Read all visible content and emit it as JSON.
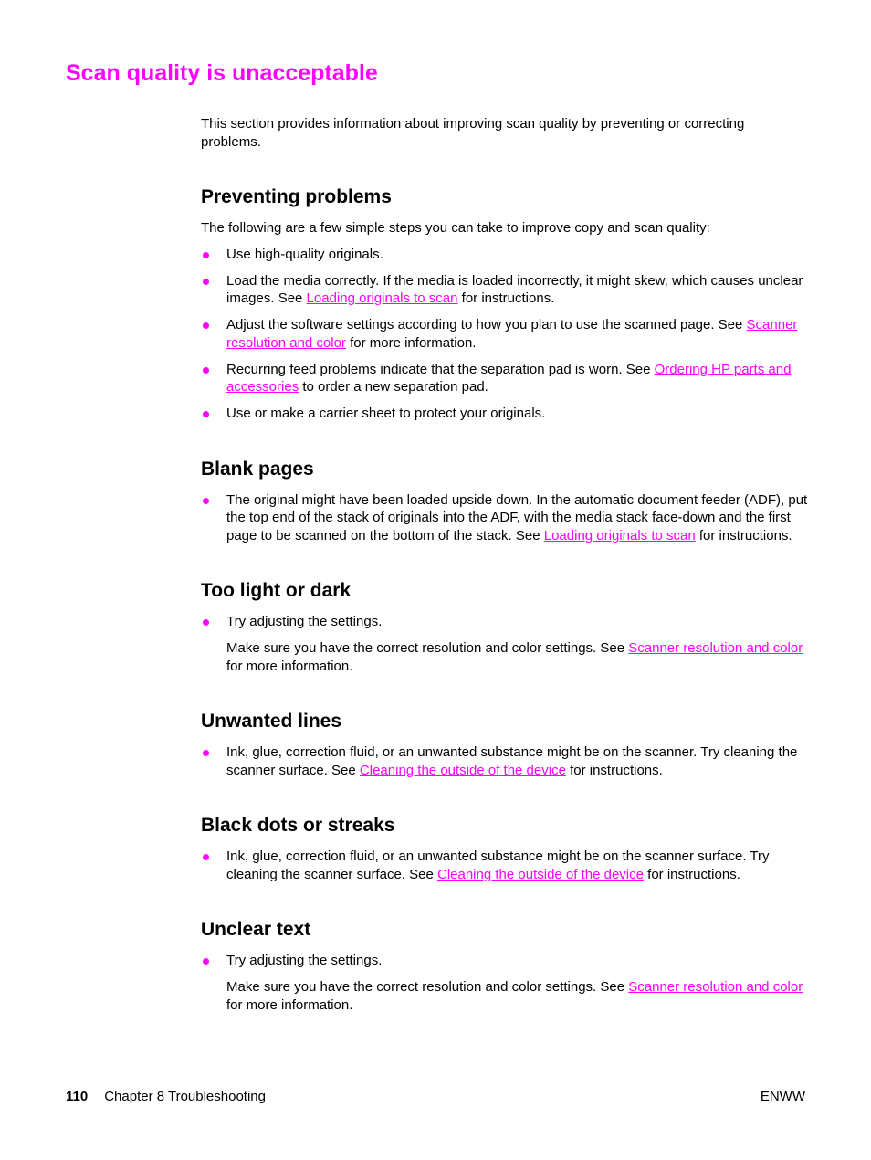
{
  "page_title": "Scan quality is unacceptable",
  "intro": "This section provides information about improving scan quality by preventing or correcting problems.",
  "sections": [
    {
      "heading": "Preventing problems",
      "lead": "The following are a few simple steps you can take to improve copy and scan quality:",
      "items": [
        {
          "before": "Use high-quality originals.",
          "link": "",
          "after": ""
        },
        {
          "before": "Load the media correctly. If the media is loaded incorrectly, it might skew, which causes unclear images. See ",
          "link": "Loading originals to scan",
          "after": " for instructions."
        },
        {
          "before": "Adjust the software settings according to how you plan to use the scanned page. See ",
          "link": "Scanner resolution and color",
          "after": " for more information."
        },
        {
          "before": "Recurring feed problems indicate that the separation pad is worn. See ",
          "link": "Ordering HP parts and accessories",
          "after": " to order a new separation pad."
        },
        {
          "before": "Use or make a carrier sheet to protect your originals.",
          "link": "",
          "after": ""
        }
      ]
    },
    {
      "heading": "Blank pages",
      "items": [
        {
          "before": "The original might have been loaded upside down. In the automatic document feeder (ADF), put the top end of the stack of originals into the ADF, with the media stack face-down and the first page to be scanned on the bottom of the stack. See ",
          "link": "Loading originals to scan",
          "after": " for instructions."
        }
      ]
    },
    {
      "heading": "Too light or dark",
      "items": [
        {
          "before": "Try adjusting the settings.",
          "link": "",
          "after": ""
        }
      ],
      "sub": {
        "before": "Make sure you have the correct resolution and color settings. See ",
        "link": "Scanner resolution and color",
        "after": " for more information."
      }
    },
    {
      "heading": "Unwanted lines",
      "items": [
        {
          "before": "Ink, glue, correction fluid, or an unwanted substance might be on the scanner. Try cleaning the scanner surface. See ",
          "link": "Cleaning the outside of the device",
          "after": " for instructions."
        }
      ]
    },
    {
      "heading": "Black dots or streaks",
      "items": [
        {
          "before": "Ink, glue, correction fluid, or an unwanted substance might be on the scanner surface. Try cleaning the scanner surface. See ",
          "link": "Cleaning the outside of the device",
          "after": " for instructions."
        }
      ]
    },
    {
      "heading": "Unclear text",
      "items": [
        {
          "before": "Try adjusting the settings.",
          "link": "",
          "after": ""
        }
      ],
      "sub": {
        "before": "Make sure you have the correct resolution and color settings. See ",
        "link": "Scanner resolution and color",
        "after": " for more information."
      }
    }
  ],
  "footer": {
    "page_number": "110",
    "chapter": "Chapter 8  Troubleshooting",
    "right": "ENWW"
  },
  "colors": {
    "accent": "#ff00ff",
    "text": "#000000"
  }
}
